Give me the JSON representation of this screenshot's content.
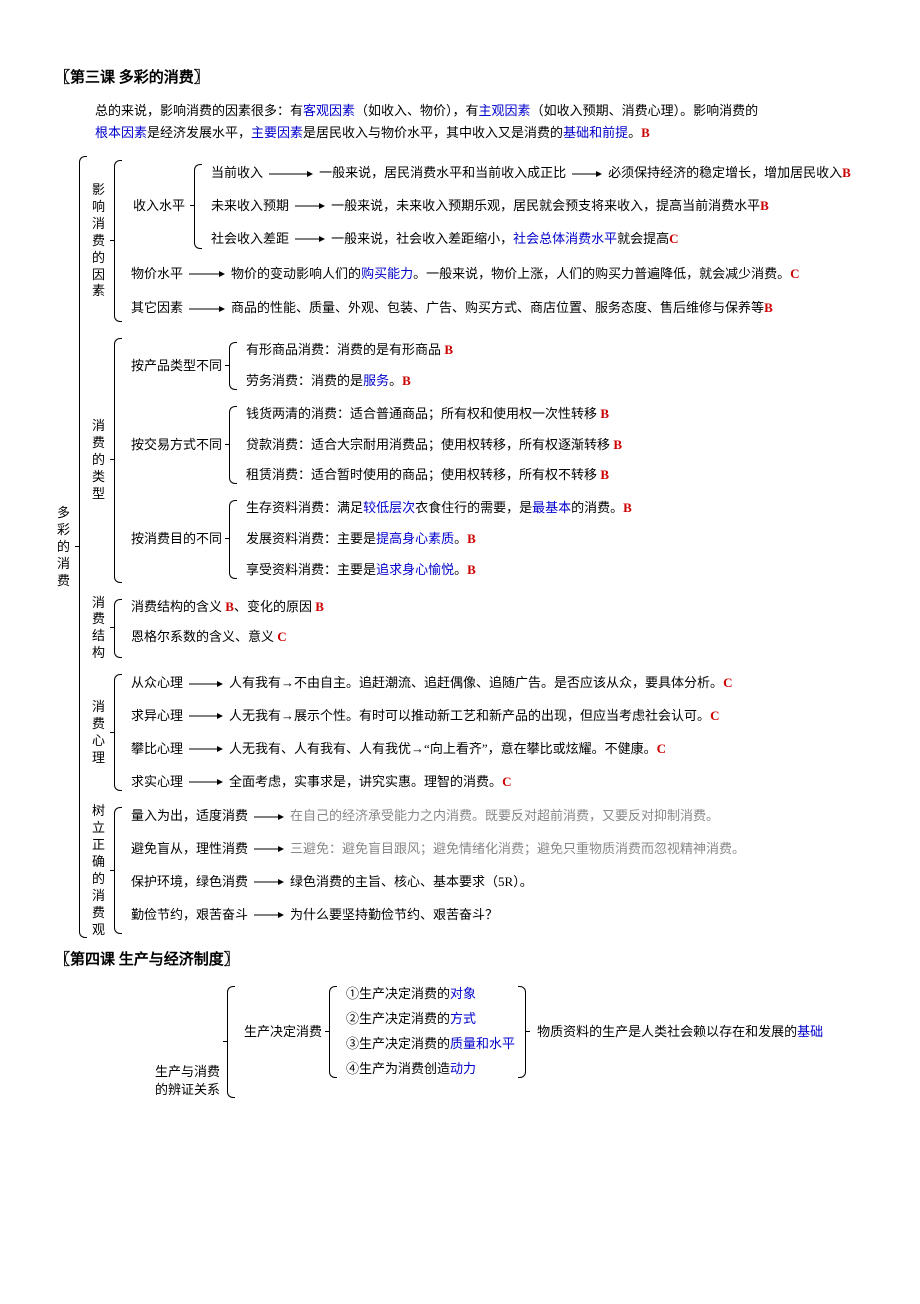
{
  "titles": {
    "lesson3": "〖第三课  多彩的消费〗",
    "lesson4": "〖第四课  生产与经济制度〗"
  },
  "root3": "多彩的消费",
  "sec1": {
    "label": "影响消费的因素",
    "intro": {
      "p1a": "总的来说，影响消费的因素很多：有",
      "p1b": "客观因素",
      "p1c": "（如收入、物价），有",
      "p1d": "主观因素",
      "p1e": "（如收入预期、消费心理）。影响消费的",
      "p2a": "根本因素",
      "p2b": "是经济发展水平，",
      "p2c": "主要因素",
      "p2d": "是居民收入与物价水平，其中收入又是消费的",
      "p2e": "基础和前提",
      "p2f": "。",
      "p2g": "B"
    },
    "income": {
      "label": "收入水平",
      "r1": {
        "a": "当前收入",
        "b": "一般来说，居民消费水平和当前收入成正比",
        "c": "必须保持经济的稳定增长，增加居民收入 ",
        "tag": "B"
      },
      "r2": {
        "a": "未来收入预期",
        "b": "一般来说，未来收入预期乐观，居民就会预支将来收入，提高当前消费水平 ",
        "tag": "B"
      },
      "r3": {
        "a": "社会收入差距",
        "b": "一般来说，社会收入差距缩小，",
        "c": "社会总体消费水平",
        "d": "就会提高 ",
        "tag": "C"
      }
    },
    "price": {
      "a": "物价水平",
      "b": "物价的变动影响人们的",
      "c": "购买能力",
      "d": "。一般来说，物价上涨，人们的购买力普遍降低，就会减少消费。",
      "tag": "C"
    },
    "other": {
      "a": "其它因素",
      "b": "商品的性能、质量、外观、包装、广告、购买方式、商店位置、服务态度、售后维修与保养等 ",
      "tag": "B"
    }
  },
  "sec2": {
    "label": "消费的类型",
    "byProduct": {
      "label": "按产品类型不同",
      "r1": {
        "a": "有形商品消费：消费的是有形商品 ",
        "tag": "B"
      },
      "r2": {
        "a": "劳务消费：消费的是",
        "b": "服务",
        "c": "。",
        "tag": "B"
      }
    },
    "byTrade": {
      "label": "按交易方式不同",
      "r1": {
        "a": "钱货两清的消费：适合普通商品；所有权和使用权一次性转移 ",
        "tag": "B"
      },
      "r2": {
        "a": "贷款消费：适合大宗耐用消费品；使用权转移，所有权逐渐转移 ",
        "tag": "B"
      },
      "r3": {
        "a": "租赁消费：适合暂时使用的商品；使用权转移，所有权不转移 ",
        "tag": "B"
      }
    },
    "byPurpose": {
      "label": "按消费目的不同",
      "r1": {
        "a": "生存资料消费：满足",
        "b": "较低层次",
        "c": "衣食住行的需要，是",
        "d": "最基本",
        "e": "的消费。",
        "tag": "B"
      },
      "r2": {
        "a": "发展资料消费：主要是",
        "b": "提高身心素质",
        "c": "。",
        "tag": "B"
      },
      "r3": {
        "a": "享受资料消费：主要是",
        "b": "追求身心愉悦",
        "c": "。",
        "tag": "B"
      }
    }
  },
  "sec3": {
    "label": "消费结构",
    "r1": {
      "a": "消费结构的含义 ",
      "tag1": "B",
      "b": "、变化的原因 ",
      "tag2": "B"
    },
    "r2": {
      "a": "恩格尔系数的含义、意义 ",
      "tag": "C"
    }
  },
  "sec4": {
    "label": "消费心理",
    "r1": {
      "a": "从众心理",
      "b": "人有我有→不由自主。追赶潮流、追赶偶像、追随广告。是否应该从众，要具体分析。",
      "tag": "C"
    },
    "r2": {
      "a": "求异心理",
      "b": "人无我有→展示个性。有时可以推动新工艺和新产品的出现，但应当考虑社会认可。",
      "tag": "C"
    },
    "r3": {
      "a": "攀比心理",
      "b": "人无我有、人有我有、人有我优→“向上看齐”，意在攀比或炫耀。不健康。",
      "tag": "C"
    },
    "r4": {
      "a": "求实心理",
      "b": "全面考虑，实事求是，讲究实惠。理智的消费。",
      "tag": "C"
    }
  },
  "sec5": {
    "label": "树立正确的消费观",
    "r1": {
      "a": "量入为出，适度消费",
      "b": "在自己的经济承受能力之内消费。既要反对超前消费，又要反对抑制消费。"
    },
    "r2": {
      "a": "避免盲从，理性消费",
      "b": "三避免：避免盲目跟风；避免情绪化消费；避免只重物质消费而忽视精神消费。"
    },
    "r3": {
      "a": "保护环境，绿色消费",
      "b": "绿色消费的主旨、核心、基本要求（5R）。"
    },
    "r4": {
      "a": "勤俭节约，艰苦奋斗",
      "b": "为什么要坚持勤俭节约、艰苦奋斗？"
    }
  },
  "sec6": {
    "label": "生产与消费的辨证关系",
    "sub": "生产决定消费",
    "items": {
      "i1a": "①生产决定消费的",
      "i1b": "对象",
      "i2a": "②生产决定消费的",
      "i2b": "方式",
      "i3a": "③生产决定消费的",
      "i3b": "质量和水平",
      "i4a": "④生产为消费创造",
      "i4b": "动力"
    },
    "right": {
      "a": "物质资料的生产是人类社会赖以存在和发展的",
      "b": "基础"
    }
  }
}
